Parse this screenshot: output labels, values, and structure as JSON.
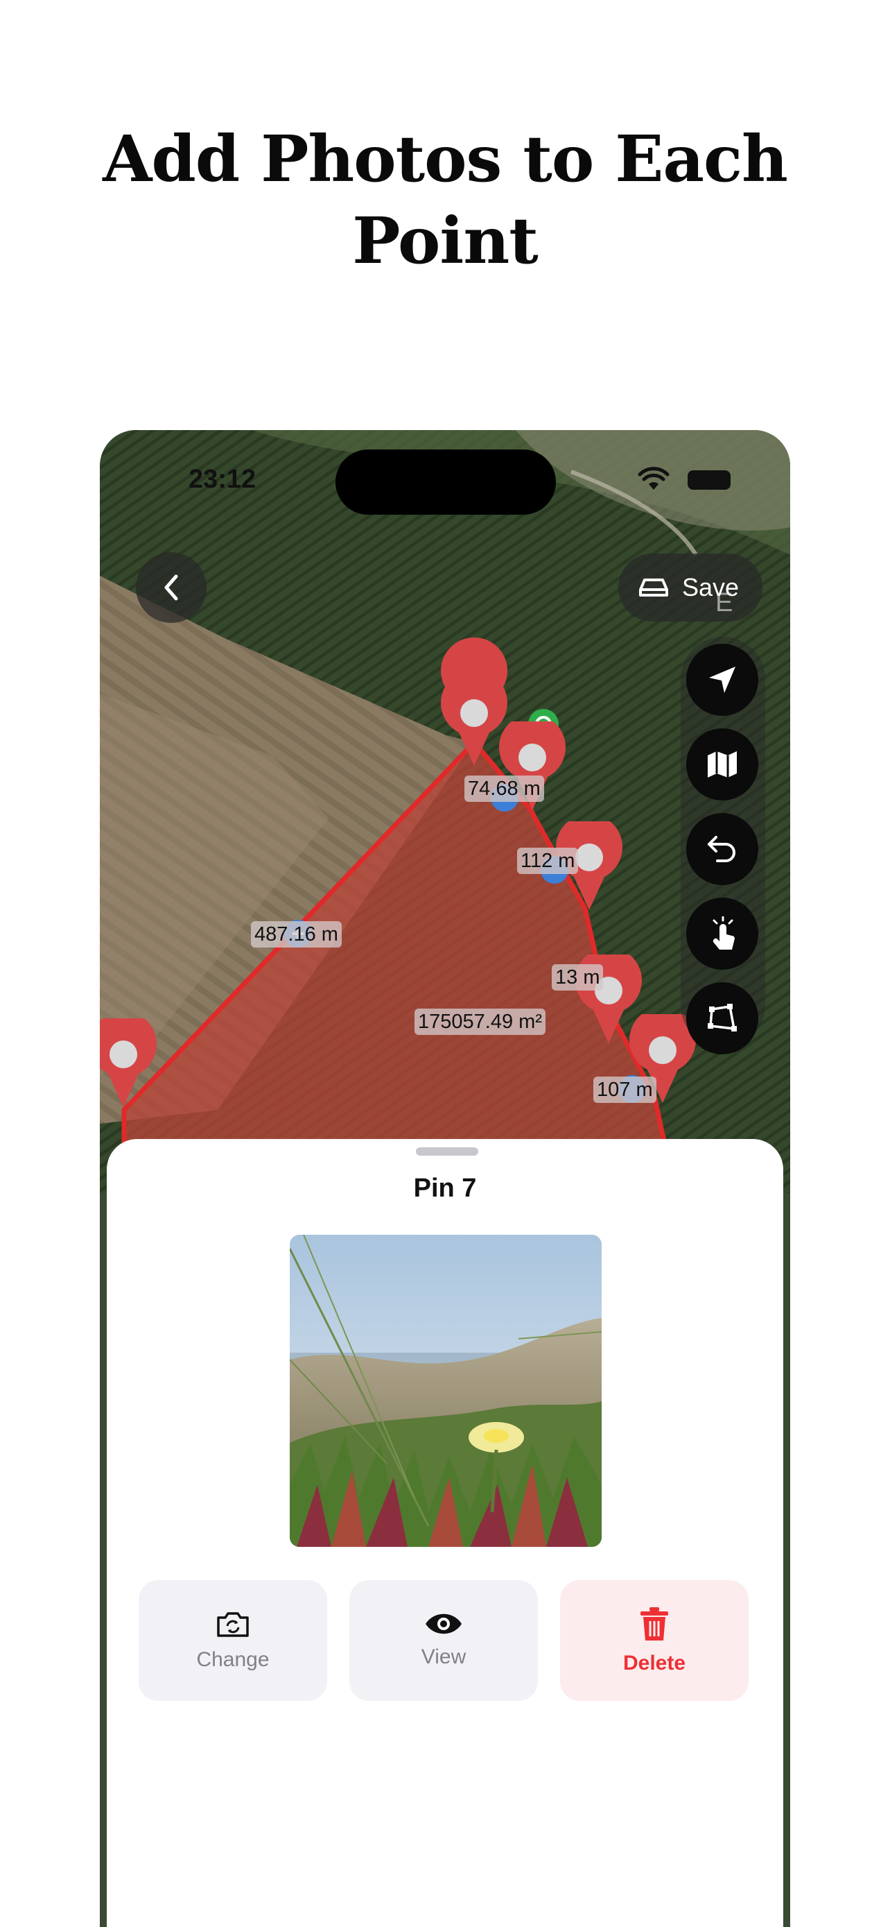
{
  "headline": {
    "line1": "Add Photos to Each",
    "line2": "Point"
  },
  "status_bar": {
    "time": "23:12"
  },
  "toolbar": {
    "save_label": "Save",
    "compass_letter": "E"
  },
  "icons": {
    "back": "chevron-left-icon",
    "save": "save-drive-icon",
    "locate": "location-arrow-icon",
    "map_type": "map-icon",
    "undo": "undo-icon",
    "tap_mode": "tap-hand-icon",
    "polygon": "polygon-icon",
    "change": "camera-rotate-icon",
    "view": "eye-icon",
    "delete": "trash-icon"
  },
  "map": {
    "area_label": "175057.49 m²",
    "edge_labels": [
      "74.68 m",
      "112 m",
      "487.16 m",
      "13 m",
      "107 m"
    ]
  },
  "sheet": {
    "title": "Pin 7",
    "actions": {
      "change": "Change",
      "view": "View",
      "delete": "Delete"
    }
  },
  "colors": {
    "pin": "#d64545",
    "polygon_fill": "#b8453a",
    "delete": "#ee3034",
    "accent_blue": "#3d7fd6"
  }
}
